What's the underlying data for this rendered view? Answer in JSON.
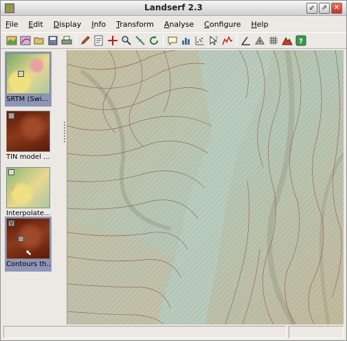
{
  "window": {
    "title": "Landserf 2.3",
    "buttons": [
      "minimize",
      "maximize",
      "close"
    ]
  },
  "menu": [
    "File",
    "Edit",
    "Display",
    "Info",
    "Transform",
    "Analyse",
    "Configure",
    "Help"
  ],
  "toolbar": {
    "groups": [
      [
        "raster-icon",
        "vector-icon",
        "open-folder-icon",
        "save-icon",
        "print-icon"
      ],
      [
        "pencil-icon",
        "edit-attributes-icon",
        "pan-icon",
        "zoom-icon",
        "query-icon",
        "refresh-icon"
      ],
      [
        "annotate-icon",
        "bar-chart-icon",
        "scatter-icon",
        "query-point-icon",
        "profile-icon"
      ],
      [
        "angle-icon",
        "triangulate-icon",
        "grid-icon",
        "relief-icon",
        "help-icon"
      ]
    ]
  },
  "thumbnails": [
    {
      "label": "SRTM (Swi...",
      "selected": true,
      "checked": false,
      "style": "hypsometric"
    },
    {
      "label": "TIN model ...",
      "selected": false,
      "checked": false,
      "style": "red-relief"
    },
    {
      "label": "Interpolate...",
      "selected": false,
      "checked": false,
      "style": "hypsometric"
    },
    {
      "label": "Contours th...",
      "selected": true,
      "checked": true,
      "checkmark": "V",
      "style": "red-relief"
    }
  ],
  "colors": {
    "map_low": "#b7cdbe",
    "map_high": "#c8bd9e",
    "contour": "#8b4a3c",
    "selection": "#8d96b8",
    "red_relief": "#7a2a1a"
  },
  "status": {
    "left": "",
    "right": ""
  }
}
